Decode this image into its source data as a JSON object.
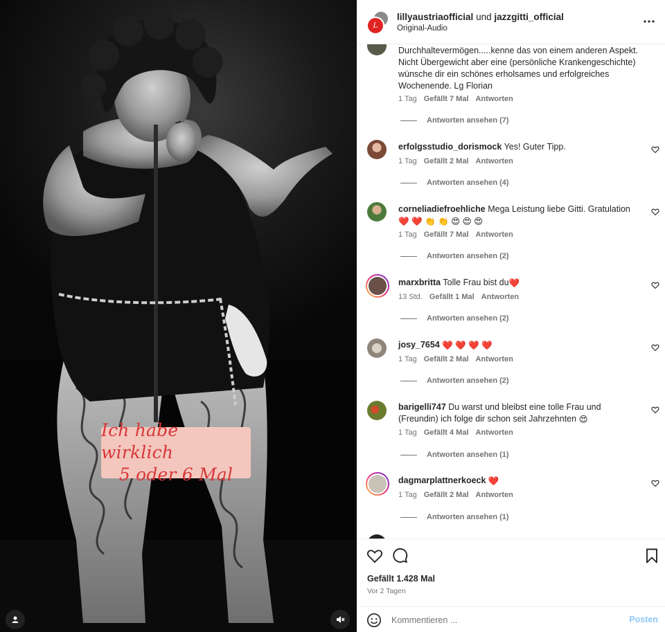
{
  "media": {
    "caption_lines": [
      "Ich habe wirklich",
      "5 oder 6 Mal"
    ],
    "caption_bg": "#f3c7bd",
    "caption_color": "#d8373b",
    "buttons": [
      "user-tag-icon",
      "mute-icon"
    ]
  },
  "header": {
    "author_1": "lillyaustriaofficial",
    "joiner": "und",
    "author_2": "jazzgitti_official",
    "audio": "Original-Audio",
    "more_icon": "more-horizontal-icon"
  },
  "comments": [
    {
      "username": "",
      "text": "Durchhaltevermögen.....kenne das von einem anderen Aspekt. Nicht Übergewicht aber eine (persönliche Krankengeschichte) wünsche dir ein schönes erholsames und erfolgreiches Wochenende. Lg Florian",
      "time": "1 Tag",
      "likes": "Gefällt 7 Mal",
      "reply": "Antworten",
      "view_replies": "Antworten ansehen (7)"
    },
    {
      "username": "erfolgsstudio_dorismock",
      "text": "Yes! Guter Tipp.",
      "time": "1 Tag",
      "likes": "Gefällt 2 Mal",
      "reply": "Antworten",
      "view_replies": "Antworten ansehen (4)"
    },
    {
      "username": "corneliadiefroehliche",
      "text": "Mega Leistung liebe Gitti. Gratulation",
      "emoji": "❤️ ❤️ 👏 👏 😍 😍 😍",
      "time": "1 Tag",
      "likes": "Gefällt 7 Mal",
      "reply": "Antworten",
      "view_replies": "Antworten ansehen (2)"
    },
    {
      "username": "marxbritta",
      "text": "Tolle Frau bist du",
      "emoji": "❤️",
      "time": "13 Std.",
      "likes": "Gefällt 1 Mal",
      "reply": "Antworten",
      "view_replies": "Antworten ansehen (2)"
    },
    {
      "username": "josy_7654",
      "text": "",
      "emoji": "❤️ ❤️ ❤️ ❤️",
      "time": "1 Tag",
      "likes": "Gefällt 2 Mal",
      "reply": "Antworten",
      "view_replies": "Antworten ansehen (2)"
    },
    {
      "username": "barigelli747",
      "text": "Du warst und bleibst eine tolle Frau und (Freundin) ich folge dir schon seit Jahrzehnten",
      "emoji": "😍",
      "time": "1 Tag",
      "likes": "Gefällt 4 Mal",
      "reply": "Antworten",
      "view_replies": "Antworten ansehen (1)"
    },
    {
      "username": "dagmarplattnerkoeck",
      "text": "",
      "emoji": "❤️",
      "time": "1 Tag",
      "likes": "Gefällt 2 Mal",
      "reply": "Antworten",
      "view_replies": "Antworten ansehen (1)"
    }
  ],
  "actions": {
    "icons": [
      "heart-icon",
      "comment-icon",
      "bookmark-icon"
    ],
    "likes": "Gefällt 1.428 Mal",
    "posted": "Vor 2 Tagen"
  },
  "composer": {
    "placeholder": "Kommentieren ...",
    "post_label": "Posten",
    "post_color": "#8fc6f7"
  }
}
